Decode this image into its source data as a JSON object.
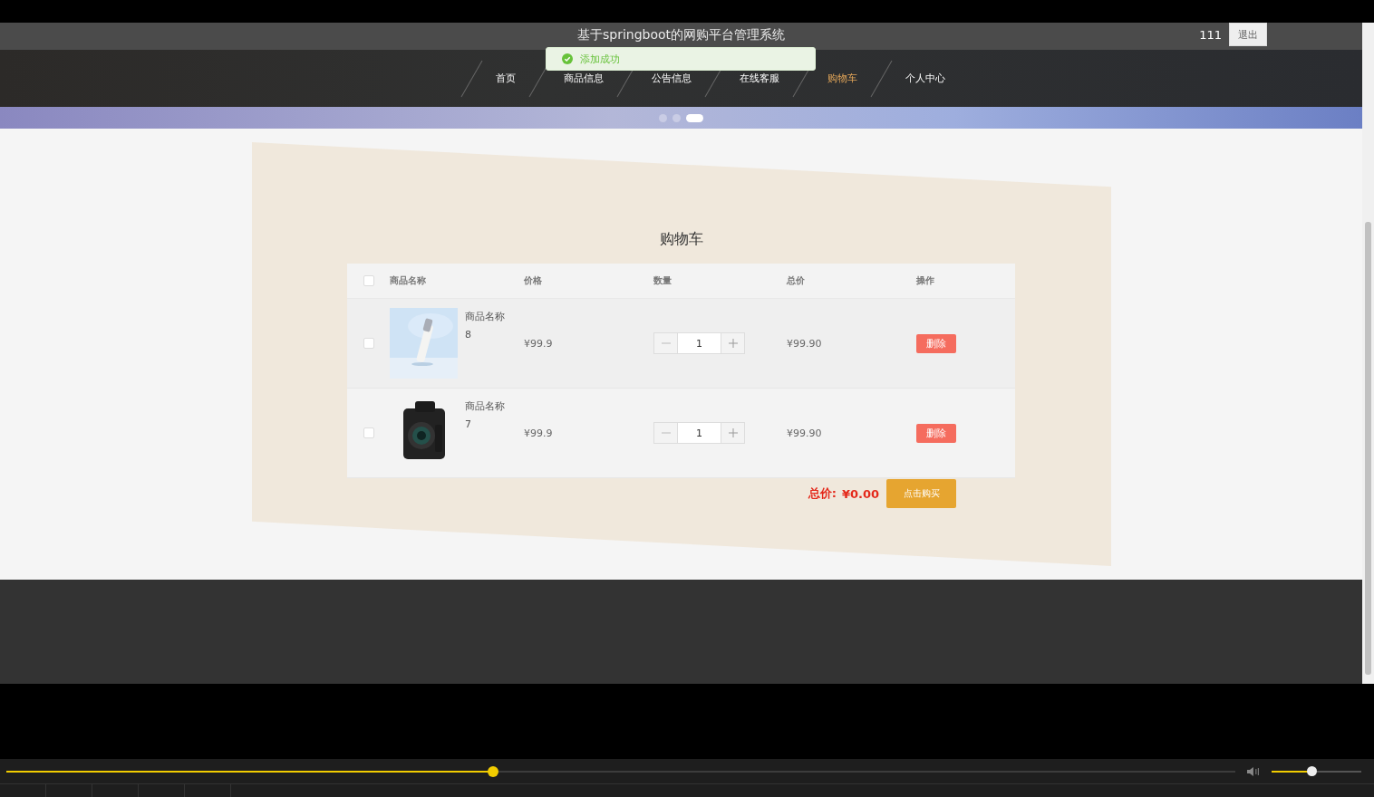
{
  "header": {
    "site_title": "基于springboot的网购平台管理系统",
    "username": "111",
    "logout_button": "退出"
  },
  "toast": {
    "message": "添加成功"
  },
  "nav": [
    {
      "label": "首页",
      "selected": false
    },
    {
      "label": "商品信息",
      "selected": false
    },
    {
      "label": "公告信息",
      "selected": false
    },
    {
      "label": "在线客服",
      "selected": false
    },
    {
      "label": "购物车",
      "selected": true
    },
    {
      "label": "个人中心",
      "selected": false
    }
  ],
  "carousel_dots": [
    {
      "selected": false
    },
    {
      "selected": false
    },
    {
      "selected": true
    }
  ],
  "cart": {
    "title": "购物车",
    "select_all_checked": false,
    "columns": [
      "商品名称",
      "价格",
      "数量",
      "总价",
      "操作"
    ],
    "rows": [
      {
        "checked": false,
        "name": "商品名称",
        "number": "8",
        "price": "¥99.9",
        "quantity": "1",
        "total": "¥99.90",
        "delete_button": "删除"
      },
      {
        "checked": false,
        "name": "商品名称",
        "number": "7",
        "price": "¥99.9",
        "quantity": "1",
        "total": "¥99.90",
        "delete_button": "删除"
      }
    ],
    "total_label": "总价:",
    "total_value": "¥0.00",
    "buy_button": "点击购买"
  },
  "player": {
    "progress": {
      "level": 0.396
    },
    "volume": {
      "level": 0.44
    }
  }
}
